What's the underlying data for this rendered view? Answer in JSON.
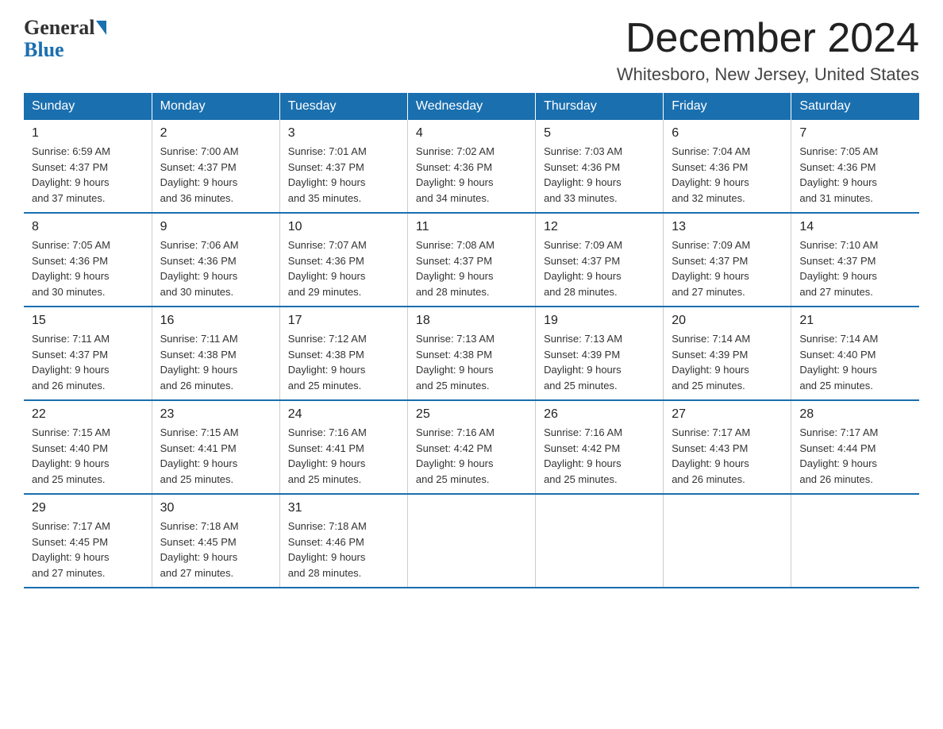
{
  "header": {
    "month_title": "December 2024",
    "location": "Whitesboro, New Jersey, United States",
    "logo_general": "General",
    "logo_blue": "Blue"
  },
  "weekdays": [
    "Sunday",
    "Monday",
    "Tuesday",
    "Wednesday",
    "Thursday",
    "Friday",
    "Saturday"
  ],
  "weeks": [
    [
      {
        "day": "1",
        "sunrise": "6:59 AM",
        "sunset": "4:37 PM",
        "daylight": "9 hours and 37 minutes."
      },
      {
        "day": "2",
        "sunrise": "7:00 AM",
        "sunset": "4:37 PM",
        "daylight": "9 hours and 36 minutes."
      },
      {
        "day": "3",
        "sunrise": "7:01 AM",
        "sunset": "4:37 PM",
        "daylight": "9 hours and 35 minutes."
      },
      {
        "day": "4",
        "sunrise": "7:02 AM",
        "sunset": "4:36 PM",
        "daylight": "9 hours and 34 minutes."
      },
      {
        "day": "5",
        "sunrise": "7:03 AM",
        "sunset": "4:36 PM",
        "daylight": "9 hours and 33 minutes."
      },
      {
        "day": "6",
        "sunrise": "7:04 AM",
        "sunset": "4:36 PM",
        "daylight": "9 hours and 32 minutes."
      },
      {
        "day": "7",
        "sunrise": "7:05 AM",
        "sunset": "4:36 PM",
        "daylight": "9 hours and 31 minutes."
      }
    ],
    [
      {
        "day": "8",
        "sunrise": "7:05 AM",
        "sunset": "4:36 PM",
        "daylight": "9 hours and 30 minutes."
      },
      {
        "day": "9",
        "sunrise": "7:06 AM",
        "sunset": "4:36 PM",
        "daylight": "9 hours and 30 minutes."
      },
      {
        "day": "10",
        "sunrise": "7:07 AM",
        "sunset": "4:36 PM",
        "daylight": "9 hours and 29 minutes."
      },
      {
        "day": "11",
        "sunrise": "7:08 AM",
        "sunset": "4:37 PM",
        "daylight": "9 hours and 28 minutes."
      },
      {
        "day": "12",
        "sunrise": "7:09 AM",
        "sunset": "4:37 PM",
        "daylight": "9 hours and 28 minutes."
      },
      {
        "day": "13",
        "sunrise": "7:09 AM",
        "sunset": "4:37 PM",
        "daylight": "9 hours and 27 minutes."
      },
      {
        "day": "14",
        "sunrise": "7:10 AM",
        "sunset": "4:37 PM",
        "daylight": "9 hours and 27 minutes."
      }
    ],
    [
      {
        "day": "15",
        "sunrise": "7:11 AM",
        "sunset": "4:37 PM",
        "daylight": "9 hours and 26 minutes."
      },
      {
        "day": "16",
        "sunrise": "7:11 AM",
        "sunset": "4:38 PM",
        "daylight": "9 hours and 26 minutes."
      },
      {
        "day": "17",
        "sunrise": "7:12 AM",
        "sunset": "4:38 PM",
        "daylight": "9 hours and 25 minutes."
      },
      {
        "day": "18",
        "sunrise": "7:13 AM",
        "sunset": "4:38 PM",
        "daylight": "9 hours and 25 minutes."
      },
      {
        "day": "19",
        "sunrise": "7:13 AM",
        "sunset": "4:39 PM",
        "daylight": "9 hours and 25 minutes."
      },
      {
        "day": "20",
        "sunrise": "7:14 AM",
        "sunset": "4:39 PM",
        "daylight": "9 hours and 25 minutes."
      },
      {
        "day": "21",
        "sunrise": "7:14 AM",
        "sunset": "4:40 PM",
        "daylight": "9 hours and 25 minutes."
      }
    ],
    [
      {
        "day": "22",
        "sunrise": "7:15 AM",
        "sunset": "4:40 PM",
        "daylight": "9 hours and 25 minutes."
      },
      {
        "day": "23",
        "sunrise": "7:15 AM",
        "sunset": "4:41 PM",
        "daylight": "9 hours and 25 minutes."
      },
      {
        "day": "24",
        "sunrise": "7:16 AM",
        "sunset": "4:41 PM",
        "daylight": "9 hours and 25 minutes."
      },
      {
        "day": "25",
        "sunrise": "7:16 AM",
        "sunset": "4:42 PM",
        "daylight": "9 hours and 25 minutes."
      },
      {
        "day": "26",
        "sunrise": "7:16 AM",
        "sunset": "4:42 PM",
        "daylight": "9 hours and 25 minutes."
      },
      {
        "day": "27",
        "sunrise": "7:17 AM",
        "sunset": "4:43 PM",
        "daylight": "9 hours and 26 minutes."
      },
      {
        "day": "28",
        "sunrise": "7:17 AM",
        "sunset": "4:44 PM",
        "daylight": "9 hours and 26 minutes."
      }
    ],
    [
      {
        "day": "29",
        "sunrise": "7:17 AM",
        "sunset": "4:45 PM",
        "daylight": "9 hours and 27 minutes."
      },
      {
        "day": "30",
        "sunrise": "7:18 AM",
        "sunset": "4:45 PM",
        "daylight": "9 hours and 27 minutes."
      },
      {
        "day": "31",
        "sunrise": "7:18 AM",
        "sunset": "4:46 PM",
        "daylight": "9 hours and 28 minutes."
      },
      null,
      null,
      null,
      null
    ]
  ],
  "labels": {
    "sunrise": "Sunrise:",
    "sunset": "Sunset:",
    "daylight": "Daylight:"
  }
}
